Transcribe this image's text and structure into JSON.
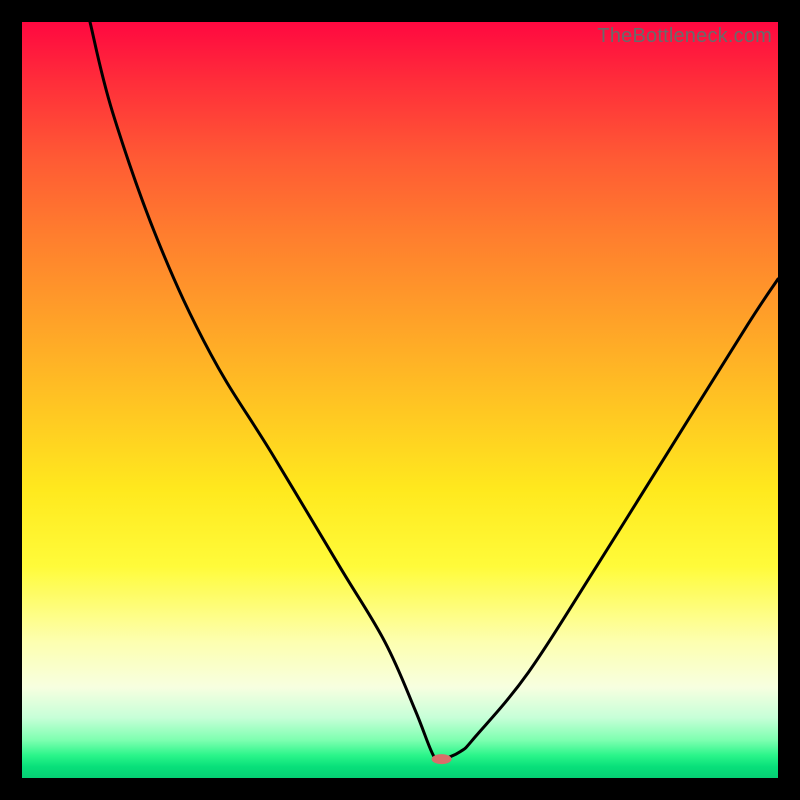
{
  "watermark": "TheBottleneck.com",
  "colors": {
    "frame": "#000000",
    "curve_stroke": "#000000"
  },
  "chart_data": {
    "type": "line",
    "title": "",
    "xlabel": "",
    "ylabel": "",
    "xlim": [
      0,
      100
    ],
    "ylim": [
      0,
      100
    ],
    "series": [
      {
        "name": "bottleneck-curve",
        "x": [
          9,
          12,
          18,
          25,
          33,
          42,
          48,
          52,
          54.4,
          55.5,
          58,
          60,
          67,
          76,
          86,
          96,
          100
        ],
        "y": [
          100,
          88,
          71,
          56,
          43,
          28,
          18,
          9,
          3,
          2.5,
          3.5,
          5.5,
          14,
          28,
          44,
          60,
          66
        ]
      }
    ],
    "marker": {
      "x": 55.5,
      "y": 2.5,
      "color": "#d86e6a",
      "rx": 10,
      "ry": 5
    }
  }
}
